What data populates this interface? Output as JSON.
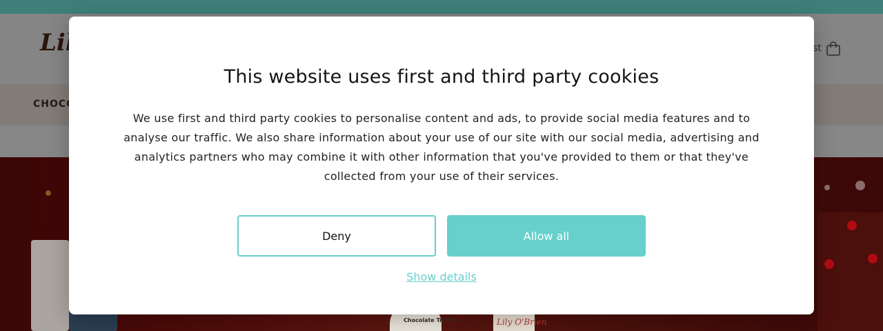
{
  "page": {
    "logo_text": "Lily",
    "header_right_text": "st",
    "nav_first_item": "CHOCO",
    "hero_tag_text": "Chocolate Truffles",
    "hero_brand_text": "Lily O'Brien"
  },
  "cookie_modal": {
    "title": "This website uses first and third party cookies",
    "body": "We use first and third party cookies to personalise content and ads, to provide social media features and to analyse our traffic. We also share information about your use of our site with our social media, advertising and analytics partners who may combine it with other information that you've provided to them or that they've collected from your use of their services.",
    "deny_label": "Deny",
    "allow_label": "Allow all",
    "details_label": "Show details"
  },
  "colors": {
    "accent": "#67cfcc",
    "topbar": "#3f7f79"
  }
}
